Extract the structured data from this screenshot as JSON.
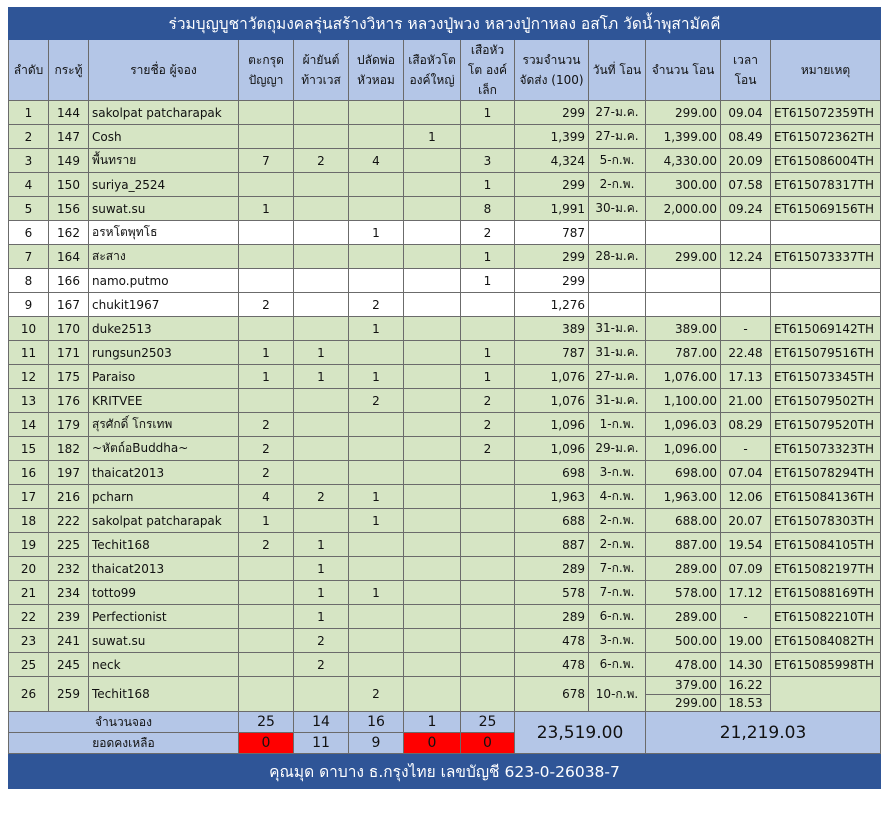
{
  "title": "ร่วมบุญบูชาวัตถุมงคลรุ่นสร้างวิหาร หลวงปู่พวง  หลวงปู่กาหลง อสโภ วัดน้ำพุสามัคคี",
  "headers": [
    "ลำดับ",
    "กระทู้",
    "รายชื่อ ผู้จอง",
    "ตะกรุด ปัญญา",
    "ผ้ายันต์ ท้าวเวส",
    "ปลัดพ่อ หัวหอม",
    "เสือหัวโต องค์ใหญ่",
    "เสือหัวโต องค์เล็ก",
    "รวมจำนวน จัดส่ง (100)",
    "วันที่ โอน",
    "จำนวน โอน",
    "เวลา โอน",
    "หมายเหตุ"
  ],
  "rows": [
    {
      "no": "1",
      "thread": "144",
      "name": "sakolpat patcharapak",
      "c1": "",
      "c2": "",
      "c3": "",
      "c4": "",
      "c5": "1",
      "total": "299",
      "date": "27-ม.ค.",
      "amount": "299.00",
      "time": "09.04",
      "note": "ET615072359TH",
      "color": "g"
    },
    {
      "no": "2",
      "thread": "147",
      "name": "Cosh",
      "c1": "",
      "c2": "",
      "c3": "",
      "c4": "1",
      "c5": "",
      "total": "1,399",
      "date": "27-ม.ค.",
      "amount": "1,399.00",
      "time": "08.49",
      "note": "ET615072362TH",
      "color": "g"
    },
    {
      "no": "3",
      "thread": "149",
      "name": "พื้นทราย",
      "c1": "7",
      "c2": "2",
      "c3": "4",
      "c4": "",
      "c5": "3",
      "total": "4,324",
      "date": "5-ก.พ.",
      "amount": "4,330.00",
      "time": "20.09",
      "note": "ET615086004TH",
      "color": "g"
    },
    {
      "no": "4",
      "thread": "150",
      "name": "suriya_2524",
      "c1": "",
      "c2": "",
      "c3": "",
      "c4": "",
      "c5": "1",
      "total": "299",
      "date": "2-ก.พ.",
      "amount": "300.00",
      "time": "07.58",
      "note": "ET615078317TH",
      "color": "g"
    },
    {
      "no": "5",
      "thread": "156",
      "name": "suwat.su",
      "c1": "1",
      "c2": "",
      "c3": "",
      "c4": "",
      "c5": "8",
      "total": "1,991",
      "date": "30-ม.ค.",
      "amount": "2,000.00",
      "time": "09.24",
      "note": "ET615069156TH",
      "color": "g"
    },
    {
      "no": "6",
      "thread": "162",
      "name": "อรหโตพุทโธ",
      "c1": "",
      "c2": "",
      "c3": "1",
      "c4": "",
      "c5": "2",
      "total": "787",
      "date": "",
      "amount": "",
      "time": "",
      "note": "",
      "color": "w"
    },
    {
      "no": "7",
      "thread": "164",
      "name": "สะสาง",
      "c1": "",
      "c2": "",
      "c3": "",
      "c4": "",
      "c5": "1",
      "total": "299",
      "date": "28-ม.ค.",
      "amount": "299.00",
      "time": "12.24",
      "note": "ET615073337TH",
      "color": "g"
    },
    {
      "no": "8",
      "thread": "166",
      "name": "namo.putmo",
      "c1": "",
      "c2": "",
      "c3": "",
      "c4": "",
      "c5": "1",
      "total": "299",
      "date": "",
      "amount": "",
      "time": "",
      "note": "",
      "color": "w"
    },
    {
      "no": "9",
      "thread": "167",
      "name": "chukit1967",
      "c1": "2",
      "c2": "",
      "c3": "2",
      "c4": "",
      "c5": "",
      "total": "1,276",
      "date": "",
      "amount": "",
      "time": "",
      "note": "",
      "color": "w"
    },
    {
      "no": "10",
      "thread": "170",
      "name": "duke2513",
      "c1": "",
      "c2": "",
      "c3": "1",
      "c4": "",
      "c5": "",
      "total": "389",
      "date": "31-ม.ค.",
      "amount": "389.00",
      "time": "-",
      "note": "ET615069142TH",
      "color": "g"
    },
    {
      "no": "11",
      "thread": "171",
      "name": "rungsun2503",
      "c1": "1",
      "c2": "1",
      "c3": "",
      "c4": "",
      "c5": "1",
      "total": "787",
      "date": "31-ม.ค.",
      "amount": "787.00",
      "time": "22.48",
      "note": "ET615079516TH",
      "color": "g"
    },
    {
      "no": "12",
      "thread": "175",
      "name": "Paraiso",
      "c1": "1",
      "c2": "1",
      "c3": "1",
      "c4": "",
      "c5": "1",
      "total": "1,076",
      "date": "27-ม.ค.",
      "amount": "1,076.00",
      "time": "17.13",
      "note": "ET615073345TH",
      "color": "g"
    },
    {
      "no": "13",
      "thread": "176",
      "name": "KRITVEE",
      "c1": "",
      "c2": "",
      "c3": "2",
      "c4": "",
      "c5": "2",
      "total": "1,076",
      "date": "31-ม.ค.",
      "amount": "1,100.00",
      "time": "21.00",
      "note": "ET615079502TH",
      "color": "g"
    },
    {
      "no": "14",
      "thread": "179",
      "name": "สุรศักดิ์ โกรเทพ",
      "c1": "2",
      "c2": "",
      "c3": "",
      "c4": "",
      "c5": "2",
      "total": "1,096",
      "date": "1-ก.พ.",
      "amount": "1,096.03",
      "time": "08.29",
      "note": "ET615079520TH",
      "color": "g"
    },
    {
      "no": "15",
      "thread": "182",
      "name": "~หัตถ์อBuddha~",
      "c1": "2",
      "c2": "",
      "c3": "",
      "c4": "",
      "c5": "2",
      "total": "1,096",
      "date": "29-ม.ค.",
      "amount": "1,096.00",
      "time": "-",
      "note": "ET615073323TH",
      "color": "g"
    },
    {
      "no": "16",
      "thread": "197",
      "name": "thaicat2013",
      "c1": "2",
      "c2": "",
      "c3": "",
      "c4": "",
      "c5": "",
      "total": "698",
      "date": "3-ก.พ.",
      "amount": "698.00",
      "time": "07.04",
      "note": "ET615078294TH",
      "color": "g"
    },
    {
      "no": "17",
      "thread": "216",
      "name": "pcharn",
      "c1": "4",
      "c2": "2",
      "c3": "1",
      "c4": "",
      "c5": "",
      "total": "1,963",
      "date": "4-ก.พ.",
      "amount": "1,963.00",
      "time": "12.06",
      "note": "ET615084136TH",
      "color": "g"
    },
    {
      "no": "18",
      "thread": "222",
      "name": "sakolpat patcharapak",
      "c1": "1",
      "c2": "",
      "c3": "1",
      "c4": "",
      "c5": "",
      "total": "688",
      "date": "2-ก.พ.",
      "amount": "688.00",
      "time": "20.07",
      "note": "ET615078303TH",
      "color": "g"
    },
    {
      "no": "19",
      "thread": "225",
      "name": "Techit168",
      "c1": "2",
      "c2": "1",
      "c3": "",
      "c4": "",
      "c5": "",
      "total": "887",
      "date": "2-ก.พ.",
      "amount": "887.00",
      "time": "19.54",
      "note": "ET615084105TH",
      "color": "g"
    },
    {
      "no": "20",
      "thread": "232",
      "name": "thaicat2013",
      "c1": "",
      "c2": "1",
      "c3": "",
      "c4": "",
      "c5": "",
      "total": "289",
      "date": "7-ก.พ.",
      "amount": "289.00",
      "time": "07.09",
      "note": "ET615082197TH",
      "color": "g"
    },
    {
      "no": "21",
      "thread": "234",
      "name": "totto99",
      "c1": "",
      "c2": "1",
      "c3": "1",
      "c4": "",
      "c5": "",
      "total": "578",
      "date": "7-ก.พ.",
      "amount": "578.00",
      "time": "17.12",
      "note": "ET615088169TH",
      "color": "g"
    },
    {
      "no": "22",
      "thread": "239",
      "name": "Perfectionist",
      "c1": "",
      "c2": "1",
      "c3": "",
      "c4": "",
      "c5": "",
      "total": "289",
      "date": "6-ก.พ.",
      "amount": "289.00",
      "time": "-",
      "note": "ET615082210TH",
      "color": "g"
    },
    {
      "no": "23",
      "thread": "241",
      "name": "suwat.su",
      "c1": "",
      "c2": "2",
      "c3": "",
      "c4": "",
      "c5": "",
      "total": "478",
      "date": "3-ก.พ.",
      "amount": "500.00",
      "time": "19.00",
      "note": "ET615084082TH",
      "color": "g"
    },
    {
      "no": "25",
      "thread": "245",
      "name": "neck",
      "c1": "",
      "c2": "2",
      "c3": "",
      "c4": "",
      "c5": "",
      "total": "478",
      "date": "6-ก.พ.",
      "amount": "478.00",
      "time": "14.30",
      "note": "ET615085998TH",
      "color": "g"
    }
  ],
  "last_row": {
    "no": "26",
    "thread": "259",
    "name": "Techit168",
    "c1": "",
    "c2": "",
    "c3": "2",
    "c4": "",
    "c5": "",
    "total": "678",
    "date": "10-ก.พ.",
    "amount1": "379.00",
    "amount2": "299.00",
    "time1": "16.22",
    "time2": "18.53",
    "note": ""
  },
  "summary": {
    "booked_label": "จำนวนจอง",
    "remaining_label": "ยอดคงเหลือ",
    "booked": [
      "25",
      "14",
      "16",
      "1",
      "25"
    ],
    "remaining": [
      "0",
      "11",
      "9",
      "0",
      "0"
    ],
    "remaining_red": [
      true,
      false,
      false,
      true,
      true
    ],
    "total_shipping": "23,519.00",
    "total_transfer": "21,219.03"
  },
  "footer": "คุณมุด ดาบาง ธ.กรุงไทย เลขบัญชี 623-0-26038-7",
  "colors": {
    "header_blue": "#2f5597",
    "light_blue": "#b4c6e7",
    "row_green": "#d6e5c4",
    "alert_red": "#ff0000"
  }
}
